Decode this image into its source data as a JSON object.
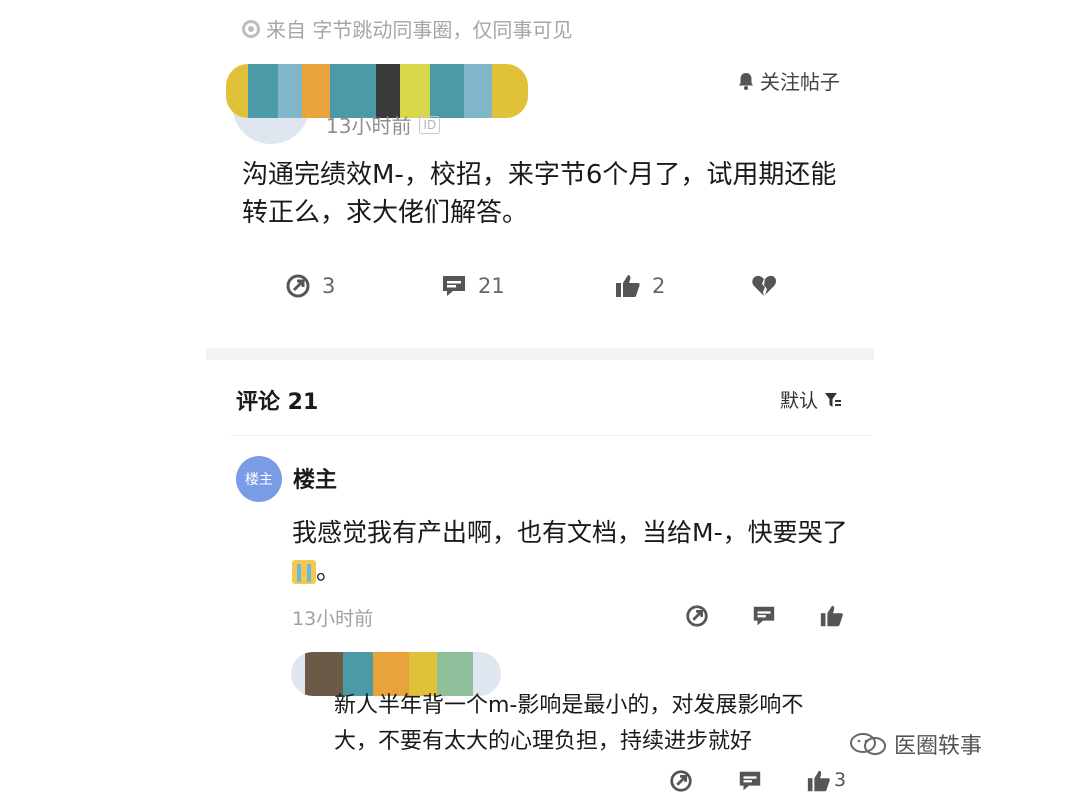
{
  "post": {
    "source": "来自 字节跳动同事圈，仅同事可见",
    "time": "13小时前",
    "id_badge": "ID",
    "follow_label": "关注帖子",
    "body": "沟通完绩效M-，校招，来字节6个月了，试用期还能转正么，求大佬们解答。",
    "share_count": "3",
    "comment_count": "21",
    "like_count": "2"
  },
  "comments_section": {
    "title": "评论 21",
    "sort_label": "默认"
  },
  "comments": [
    {
      "avatar_text": "楼主",
      "author": "楼主",
      "body_text": "我感觉我有产出啊，也有文档，当给M-，快要哭了",
      "body_end": "。",
      "time": "13小时前"
    }
  ],
  "reply": {
    "body": "新人半年背一个m-影响是最小的，对发展影响不大，不要有太大的心理负担，持续进步就好",
    "like_count": "3"
  },
  "watermark": "医圈轶事",
  "colors": {
    "accent_avatar": "#7a9ce6",
    "muted_text": "#a0a0a0",
    "censor_palette": [
      "#e2c13a",
      "#4a9aa8",
      "#3a3a3a",
      "#e8a33c",
      "#d8d84a",
      "#7fb7c8",
      "#c23a3a",
      "#6b5a46",
      "#8fbf9a"
    ]
  }
}
